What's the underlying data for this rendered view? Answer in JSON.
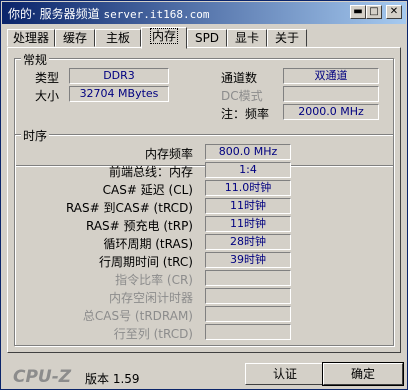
{
  "window": {
    "title_prefix": "你的",
    "title_site": "服务器频道",
    "title_url": "server.it168.com"
  },
  "tabs": [
    "处理器",
    "缓存",
    "主板",
    "内存",
    "SPD",
    "显卡",
    "关于"
  ],
  "active_tab": "内存",
  "general": {
    "title": "常规",
    "type_label": "类型",
    "type_value": "DDR3",
    "size_label": "大小",
    "size_value": "32704 MBytes",
    "channels_label": "通道数",
    "channels_value": "双通道",
    "dc_label": "DC模式",
    "dc_value": "",
    "freq_note_label": "注：频率",
    "freq_note_value": "2000.0 MHz"
  },
  "timings": {
    "title": "时序",
    "rows": [
      {
        "label": "内存频率",
        "value": "800.0 MHz",
        "disabled": false
      },
      {
        "label": "前端总线：内存",
        "value": "1:4",
        "disabled": false
      },
      {
        "label": "CAS# 延迟 (CL)",
        "value": "11.0时钟",
        "disabled": false
      },
      {
        "label": "RAS# 到CAS# (tRCD)",
        "value": "11时钟",
        "disabled": false
      },
      {
        "label": "RAS# 预充电 (tRP)",
        "value": "11时钟",
        "disabled": false
      },
      {
        "label": "循环周期 (tRAS)",
        "value": "28时钟",
        "disabled": false
      },
      {
        "label": "行周期时间 (tRC)",
        "value": "39时钟",
        "disabled": false
      },
      {
        "label": "指令比率 (CR)",
        "value": "",
        "disabled": true
      },
      {
        "label": "内存空闲计时器",
        "value": "",
        "disabled": true
      },
      {
        "label": "总CAS号 (tRDRAM)",
        "value": "",
        "disabled": true
      },
      {
        "label": "行至列 (tRCD)",
        "value": "",
        "disabled": true
      }
    ]
  },
  "footer": {
    "logo": "CPU-Z",
    "version": "版本 1.59",
    "validate_label": "认证",
    "ok_label": "确定"
  },
  "colors": {
    "titlebar_start": "#0a246a",
    "titlebar_end": "#a6caf0",
    "value_text": "#000080",
    "face": "#d4d0c8"
  }
}
